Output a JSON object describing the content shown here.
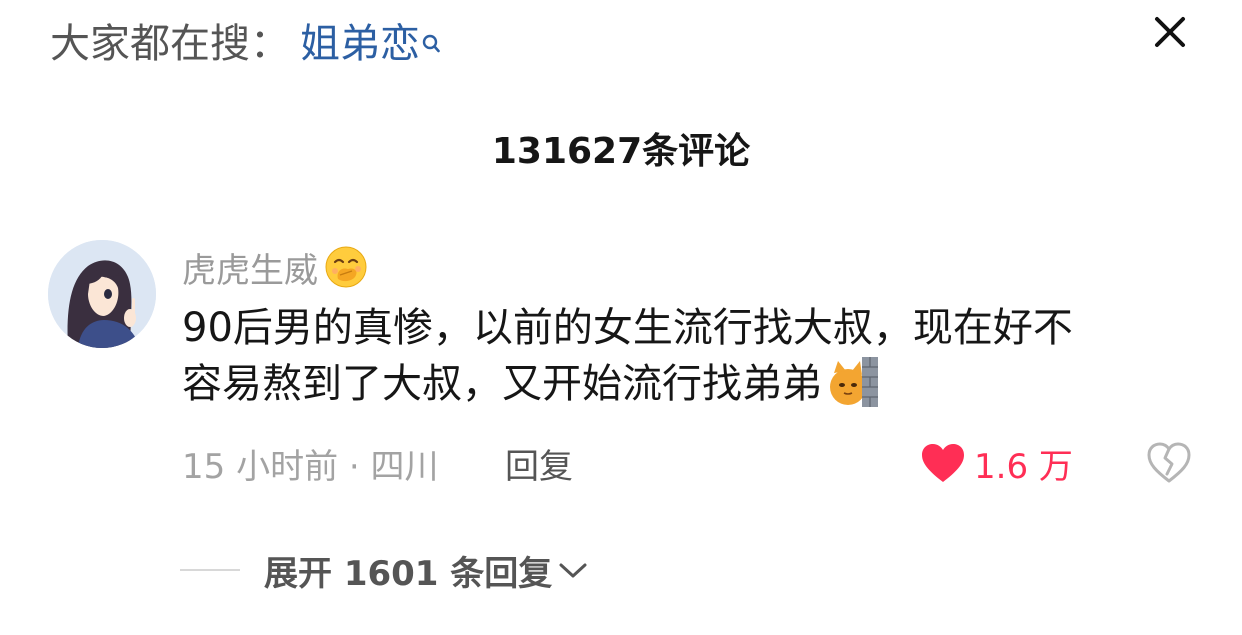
{
  "search_hint": {
    "prefix": "大家都在搜：",
    "term": "姐弟恋"
  },
  "header": {
    "comment_count": "131627条评论"
  },
  "comment": {
    "username": "虎虎生威",
    "text_line1": "90后男的真惨，以前的女生流行找大叔，现在好不",
    "text_line2": "容易熬到了大叔，又开始流行找弟弟",
    "time_location": "15 小时前 · 四川",
    "reply_label": "回复",
    "like_count": "1.6 万"
  },
  "expand_replies": {
    "label": "展开 1601 条回复"
  },
  "icons": {
    "search": "search-icon",
    "close": "close-icon",
    "like": "heart-icon",
    "dislike": "broken-heart-icon",
    "expand": "chevron-down-icon"
  },
  "colors": {
    "search_term": "#2c5fa3",
    "like": "#ff2e55",
    "muted": "#a3a3a3",
    "text": "#161616"
  }
}
